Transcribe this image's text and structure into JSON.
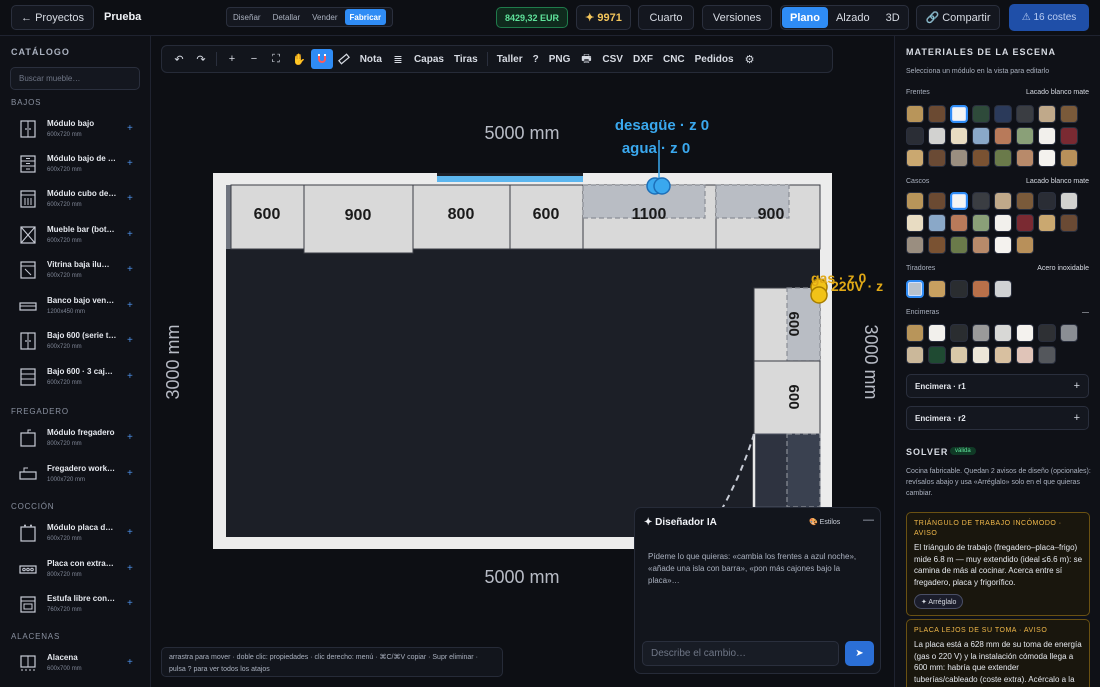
{
  "topbar": {
    "back_label": "← Proyectos",
    "project_name": "Prueba",
    "modes": [
      "Diseñar",
      "Detallar",
      "Vender",
      "Fabricar"
    ],
    "active_mode": "Fabricar",
    "price": "8429,32 EUR",
    "points": "✦ 9971",
    "room_label": "Cuarto",
    "versions_label": "Versiones",
    "views": [
      "Plano",
      "Alzado",
      "3D"
    ],
    "active_view": "Plano",
    "share_label": "🔗 Compartir",
    "costes_label": "⚠ 16 costes"
  },
  "catalog": {
    "title": "CATÁLOGO",
    "search_placeholder": "Buscar mueble…",
    "categories": [
      {
        "label": "BAJOS",
        "items": [
          {
            "name": "Módulo bajo",
            "size": "600x720 mm",
            "icon": "base-cabinet-icon"
          },
          {
            "name": "Módulo bajo de …",
            "size": "600x720 mm",
            "icon": "drawer-cabinet-icon"
          },
          {
            "name": "Módulo cubo de…",
            "size": "600x720 mm",
            "icon": "bin-cabinet-icon"
          },
          {
            "name": "Mueble bar (bot…",
            "size": "600x720 mm",
            "icon": "bottle-rack-icon"
          },
          {
            "name": "Vitrina baja ilu…",
            "size": "600x720 mm",
            "icon": "glass-cabinet-icon"
          },
          {
            "name": "Banco bajo ven…",
            "size": "1200x450 mm",
            "icon": "bench-icon"
          },
          {
            "name": "Bajo 600 (serie t…",
            "size": "600x720 mm",
            "icon": "base-cabinet-icon"
          },
          {
            "name": "Bajo 600 · 3 caj…",
            "size": "600x720 mm",
            "icon": "three-drawer-icon"
          }
        ]
      },
      {
        "label": "FREGADERO",
        "items": [
          {
            "name": "Módulo fregadero",
            "size": "800x720 mm",
            "icon": "sink-cabinet-icon"
          },
          {
            "name": "Fregadero work…",
            "size": "1000x720 mm",
            "icon": "workstation-sink-icon"
          }
        ]
      },
      {
        "label": "COCCIÓN",
        "items": [
          {
            "name": "Módulo placa d…",
            "size": "600x720 mm",
            "icon": "hob-cabinet-icon"
          },
          {
            "name": "Placa con extra…",
            "size": "800x720 mm",
            "icon": "hob-extractor-icon"
          },
          {
            "name": "Estufa libre con…",
            "size": "760x720 mm",
            "icon": "range-icon"
          }
        ]
      },
      {
        "label": "ALACENAS",
        "items": [
          {
            "name": "Alacena",
            "size": "600x700 mm",
            "icon": "wall-cabinet-icon"
          }
        ]
      }
    ]
  },
  "toolbar": {
    "undo": "↶",
    "redo": "↷",
    "zoom_in": "+",
    "zoom_out": "−",
    "fit": "⛶",
    "pan": "✋",
    "note": "Nota",
    "layers": "Capas",
    "strips": "Tiras",
    "workshop": "Taller",
    "help": "?",
    "png": "PNG",
    "csv": "CSV",
    "dxf": "DXF",
    "cnc": "CNC",
    "orders": "Pedidos",
    "settings": "⚙"
  },
  "plan": {
    "dim_top": "5000 mm",
    "dim_bottom": "5000 mm",
    "dim_left": "3000 mm",
    "dim_right": "3000 mm",
    "top_run": [
      "600",
      "900",
      "800",
      "600",
      "1100",
      "900"
    ],
    "right_run": [
      "600",
      "600"
    ],
    "drain_label": "desagüe · z 0",
    "water_label": "agua · z 0",
    "gas_label": "gas · z 0",
    "power_label": "220V · z"
  },
  "hint": "arrastra para mover · doble clic: propiedades · clic derecho: menú · ⌘C/⌘V copiar · Supr eliminar · pulsa ? para ver todos los atajos",
  "ai": {
    "title": "✦ Diseñador IA",
    "styles_label": "🎨 Estilos",
    "minimize": "—",
    "body": "Pídeme lo que quieras: «cambia los frentes a azul noche», «añade una isla con barra», «pon más cajones bajo la placa»…",
    "input_placeholder": "Describe el cambio…",
    "send": "➤"
  },
  "materials": {
    "title": "MATERIALES DE LA ESCENA",
    "subtitle": "Selecciona un módulo en la vista para editarlo",
    "frentes": {
      "label": "Frentes",
      "value": "Lacado blanco mate",
      "swatches": [
        "#b8955a",
        "#6b4a32",
        "#f4f4f2",
        "#2e4a3a",
        "#2b3a5a",
        "#3a3d42",
        "#c0a98a",
        "#7a5a3a",
        "#2a2d35",
        "#d2d2d0",
        "#e8dcc2",
        "#8aa8c8",
        "#b87a5a",
        "#8aa078",
        "#f2f0ec",
        "#7a2a32",
        "#caa870",
        "#6a4a34",
        "#9a8e80",
        "#7a5232",
        "#6a7a4a",
        "#b88a6a",
        "#f4f2ee",
        "#b8905a"
      ],
      "selected": 2
    },
    "cascos": {
      "label": "Cascos",
      "value": "Lacado blanco mate",
      "swatches": [
        "#b8955a",
        "#6b4a32",
        "#f4f4f2",
        "#3a3d42",
        "#c0a98a",
        "#7a5a3a",
        "#2a2d35",
        "#d2d2d0",
        "#e8dcc2",
        "#8aa8c8",
        "#b87a5a",
        "#8aa078",
        "#f2f0ec",
        "#7a2a32",
        "#caa870",
        "#6a4a34",
        "#9a8e80",
        "#7a5232",
        "#6a7a4a",
        "#b88a6a",
        "#f4f2ee",
        "#b8905a"
      ],
      "selected": 2
    },
    "tiradores": {
      "label": "Tiradores",
      "value": "Acero inoxidable",
      "swatches": [
        "#b8c2cc",
        "#c8a060",
        "#2a2d30",
        "#b8704a",
        "#d0d2d4"
      ],
      "selected": 0
    },
    "encimeras": {
      "label": "Encimeras",
      "value": "—",
      "swatches": [
        "#b8955a",
        "#f2f0ec",
        "#2a2d30",
        "#9a9a9a",
        "#d8d8d6",
        "#f4f2ee",
        "#2e3034",
        "#8a8e94",
        "#cbb89a",
        "#1f4a32",
        "#d8c8a8",
        "#ece6d8",
        "#d8c0a0",
        "#e0c4b8",
        "#54575c"
      ],
      "selected": -1
    },
    "worktops": [
      "Encimera · r1",
      "Encimera · r2"
    ]
  },
  "solver": {
    "title": "SOLVER",
    "badge": "válida",
    "text": "Cocina fabricable. Quedan 2 avisos de diseño (opcionales): revísalos abajo y usa «Arréglalo» solo en el que quieras cambiar.",
    "warnings": [
      {
        "title": "TRIÁNGULO DE TRABAJO INCÓMODO · AVISO",
        "text": "El triángulo de trabajo (fregadero–placa–frigo) mide 6.8 m — muy extendido (ideal ≤6.6 m): se camina de más al cocinar. Acerca entre sí fregadero, placa y frigorífico.",
        "button": "✦ Arréglalo"
      },
      {
        "title": "PLACA LEJOS DE SU TOMA · AVISO",
        "text": "La placa está a 628 mm de su toma de energía (gas o 220 V) y la instalación cómoda llega a 600 mm: habría que extender tuberías/cableado (coste extra). Acércalo a la",
        "button": ""
      }
    ]
  }
}
